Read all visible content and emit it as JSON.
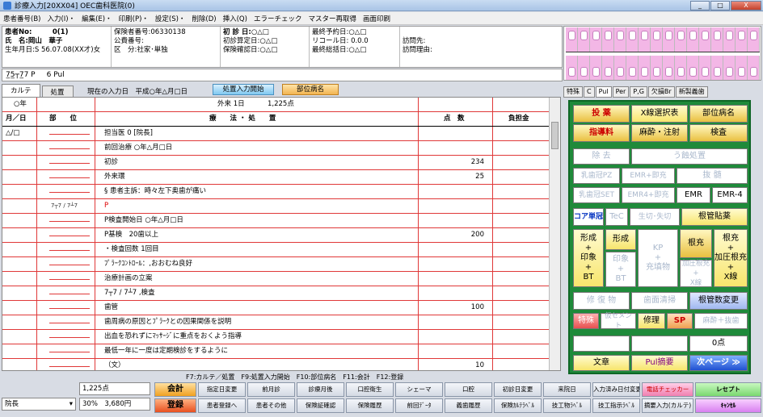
{
  "window": {
    "title": "診療入力[20XX04] OEC歯科医院(0)",
    "min": "_",
    "max": "□",
    "close": "X"
  },
  "menu": [
    "患者番号(B)",
    "入力(I)・",
    "編集(E)・",
    "印刷(P)・",
    "設定(S)・",
    "削除(D)",
    "挿入(Q)",
    "エラーチェック",
    "マスター再取得",
    "画面印刷"
  ],
  "patient": {
    "col1": [
      "患者No:　　　0(1)",
      "氏　名:岡山　華子",
      "生年月日:S 56.07.08(XX才)女"
    ],
    "col2": [
      "保険者番号:06330138",
      "公費番号:",
      "区　分:社家･単独"
    ],
    "col3": [
      "初 診 日:○△□",
      "初診算定日:○△□",
      "保険確認日:○△□"
    ],
    "col4": [
      "最終予約日:○△□",
      "リコール日: 0.0.0",
      "最終総括日:○△□"
    ],
    "col5": [
      "訪問先:",
      "訪問理由:"
    ]
  },
  "formula": [
    "7̲5̲┬7̲7  P",
    "6 Pul"
  ],
  "tabs": {
    "karte": "カルテ",
    "shochi": "処置",
    "current_date": "現在の入力日　平成○年△月□日",
    "start_btn": "処置入力開始",
    "byomei_btn": "部位病名"
  },
  "chart": {
    "header": {
      "year": "○年",
      "visit": "外来 1日",
      "points": "1,225点"
    },
    "cols": {
      "date": "月／日",
      "site": "部　　位",
      "treatment": "療　　法 ・ 処　　置",
      "points": "点　数",
      "burden": "負担金"
    },
    "rows": [
      {
        "date": "△/□",
        "site": "",
        "text": "担当医 0 [院長]",
        "pts": ""
      },
      {
        "date": "",
        "site": "",
        "text": "前回治療 ○年△月□日",
        "pts": ""
      },
      {
        "date": "",
        "site": "",
        "text": "初診",
        "pts": "234"
      },
      {
        "date": "",
        "site": "",
        "text": "外来環",
        "pts": "25"
      },
      {
        "date": "",
        "site": "",
        "text": "§ 患者主訴：時々左下奥歯が痛い",
        "pts": ""
      },
      {
        "date": "",
        "site": "7┬7 / 7┴7",
        "text": "P",
        "pts": ""
      },
      {
        "date": "",
        "site": "",
        "text": "P検査開始日 ○年△月□日",
        "pts": ""
      },
      {
        "date": "",
        "site": "",
        "text": "P基検　20歯以上",
        "pts": "200"
      },
      {
        "date": "",
        "site": "",
        "text": "・検査回数 1回目",
        "pts": ""
      },
      {
        "date": "",
        "site": "",
        "text": "ﾌﾟﾗｰｸｺﾝﾄﾛｰﾙ：,おおむね良好",
        "pts": ""
      },
      {
        "date": "",
        "site": "",
        "text": "治療計画の立案",
        "pts": ""
      },
      {
        "date": "",
        "site": "",
        "text": "7┬7 / 7┴7 ,検査",
        "pts": ""
      },
      {
        "date": "",
        "site": "",
        "text": "歯管",
        "pts": "100"
      },
      {
        "date": "",
        "site": "",
        "text": "歯周病の原因とﾌﾟﾗｰｸとの因果関係を説明",
        "pts": ""
      },
      {
        "date": "",
        "site": "",
        "text": "出血を恐れずにﾏｯｻｰｼﾞに重点をおくよう指導",
        "pts": ""
      },
      {
        "date": "",
        "site": "",
        "text": "最低一年に一度は定期検診をするように",
        "pts": ""
      },
      {
        "date": "",
        "site": "",
        "text": "（文）",
        "pts": "10"
      }
    ]
  },
  "fkeys": "F7:カルテ／処置　F9:処置入力開始　F10:部位病名　F11:会計　F12:登録",
  "bottom": {
    "points": "1,225点",
    "doctor": "院長",
    "rate": "30%　3,680円",
    "kaikei": "会計",
    "touroku": "登録",
    "row1": [
      "指定日変更",
      "前月診",
      "診療月後",
      "口腔衛生",
      "シェーマ",
      "口腔",
      "初診日変更",
      "来院日",
      "入力済み日付変更",
      "電話チェッカー"
    ],
    "row2": [
      "患者登録へ",
      "患者その他",
      "保険証確認",
      "保険履歴",
      "前回ﾃﾞｰﾀ",
      "義歯履歴",
      "保険ｶﾙﾃﾗﾍﾞﾙ",
      "技工物ﾗﾍﾞﾙ",
      "技工指示ﾗﾍﾞﾙ",
      "摘要入力(カルテ)"
    ],
    "reset": "レセプト",
    "cancel": "ｷｬﾝｾﾙ"
  },
  "right_tabs": [
    "特殊",
    "C",
    "Pul",
    "Per",
    "P,G",
    "欠損Br",
    "新製義歯"
  ],
  "right_buttons": {
    "tousaku": "投 薬",
    "xsen": "X線選択表",
    "buiby": "部位病名",
    "shidou": "指導料",
    "masui": "麻酔・注射",
    "kensa": "検査",
    "jokyo": "除 去",
    "ushoku": "う蝕処置",
    "nyu_pz": "乳歯冠PZ",
    "emr_soku": "EMR+即充",
    "basshi": "抜 髄",
    "nyu_set": "乳歯冠SET",
    "emr4": "EMR4+即充",
    "emr": "EMR",
    "emr_4": "EMR-4",
    "core": "コア単冠",
    "tec": "TeC",
    "seikatsu": "生切･失切",
    "konkan": "根管貼薬",
    "keisei": "形成\n+\n印象\n+\nBT",
    "keisei2": "形成",
    "inbt": "印象\n+\nBT",
    "kp": "KP\n+\n充填物",
    "konju": "根充",
    "konju_kaatsu": "加圧根充\n+\nX線",
    "konju_x": "根充\n+\n加圧根充\n+\nX線",
    "shufuku": "修 復 物",
    "shimen": "歯面清掃",
    "konkan_hen": "根管数変更",
    "tokushu": "特殊",
    "kari": "仮セメント",
    "shuri": "修理",
    "sp": "SP",
    "masui_bas": "麻酔＋抜歯",
    "o_ten": "0点",
    "bunsho": "文章",
    "pul_tekiyo": "Pul摘要",
    "next": "次ページ ≫"
  }
}
